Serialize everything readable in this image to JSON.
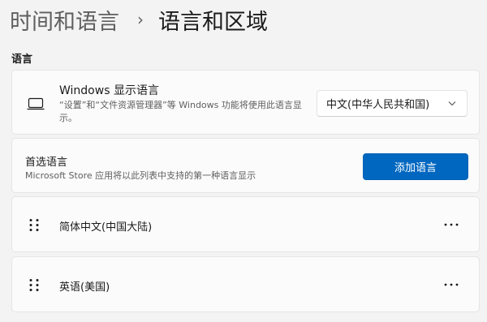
{
  "breadcrumb": {
    "parent": "时间和语言",
    "separator": "›",
    "current": "语言和区域"
  },
  "language_section": {
    "label": "语言"
  },
  "display_language": {
    "icon": "monitor-icon",
    "title": "Windows 显示语言",
    "description": "“设置”和“文件资源管理器”等 Windows 功能将使用此语言显示。",
    "selected": "中文(中华人民共和国)"
  },
  "preferred_languages": {
    "title": "首选语言",
    "description": "Microsoft Store 应用将以此列表中支持的第一种语言显示",
    "add_button": "添加语言",
    "items": [
      {
        "name": "简体中文(中国大陆)",
        "more": "more-options-icon"
      },
      {
        "name": "英语(美国)",
        "more": "more-options-icon"
      }
    ]
  },
  "colors": {
    "accent": "#0067c0",
    "background": "#f3f3f3",
    "card": "#fbfbfb"
  }
}
